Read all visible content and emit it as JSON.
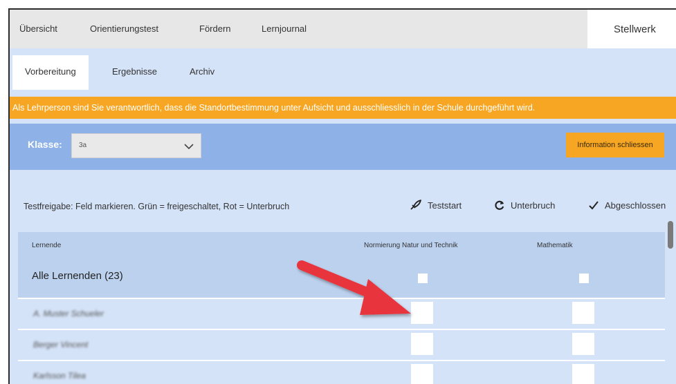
{
  "topnav": {
    "items": [
      "Übersicht",
      "Orientierungstest",
      "Fördern",
      "Lernjournal"
    ],
    "brand": "Stellwerk"
  },
  "subtabs": {
    "items": [
      "Vorbereitung",
      "Ergebnisse",
      "Archiv"
    ],
    "active": "Vorbereitung"
  },
  "warning": "Als Lehrperson sind Sie verantwortlich, dass die Standortbestimmung unter Aufsicht und ausschliesslich in der Schule durchgeführt wird.",
  "classbar": {
    "label": "Klasse:",
    "selected": "3a",
    "info_button": "Information schliessen"
  },
  "freigabe_text": "Testfreigabe: Feld markieren. Grün = freigeschaltet, Rot = Unterbruch",
  "legend": [
    {
      "label": "Teststart",
      "icon": "rocket-icon"
    },
    {
      "label": "Unterbruch",
      "icon": "refresh-icon"
    },
    {
      "label": "Abgeschlossen",
      "icon": "check-icon"
    }
  ],
  "table": {
    "col_learners": "Lernende",
    "col_test1": "Normierung Natur und Technik",
    "col_test2": "Mathematik",
    "all_row": "Alle Lernenden (23)",
    "rows": [
      "A. Muster Schueler",
      "Berger Vincent",
      "Karlsson Tilea"
    ]
  },
  "colors": {
    "warning": "#f6a623",
    "classbar": "#8eb2e8",
    "panel": "#d5e3f8",
    "arrow": "#e8343c"
  }
}
